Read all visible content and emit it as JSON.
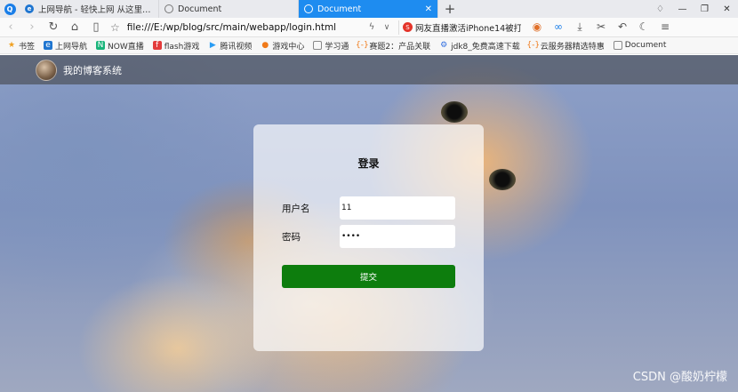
{
  "tabs": [
    {
      "title": "上网导航 - 轻快上网 从这里开始",
      "icon": "ie-icon",
      "active": false
    },
    {
      "title": "Document",
      "icon": "globe-icon",
      "active": false
    },
    {
      "title": "Document",
      "icon": "globe-icon",
      "active": true
    }
  ],
  "address_bar": {
    "url": "file:///E:/wp/blog/src/main/webapp/login.html"
  },
  "search_box": {
    "text": "网友直播激活iPhone14被打"
  },
  "bookmarks": [
    {
      "label": "书签",
      "icon": "star-icon"
    },
    {
      "label": "上网导航",
      "icon": "ie-icon"
    },
    {
      "label": "NOW直播",
      "icon": "now-icon"
    },
    {
      "label": "flash游戏",
      "icon": "flash-icon"
    },
    {
      "label": "腾讯视频",
      "icon": "play-icon"
    },
    {
      "label": "游戏中心",
      "icon": "gamepad-icon"
    },
    {
      "label": "学习通",
      "icon": "globe-icon"
    },
    {
      "label": "赛题2：产品关联",
      "icon": "code-icon"
    },
    {
      "label": "jdk8_免费高速下载",
      "icon": "gear-icon"
    },
    {
      "label": "云服务器精选特惠",
      "icon": "code-icon"
    },
    {
      "label": "Document",
      "icon": "globe-icon"
    }
  ],
  "site": {
    "title": "我的博客系统"
  },
  "login": {
    "title": "登录",
    "username_label": "用户名",
    "username_value": "11",
    "password_label": "密码",
    "password_value": "1111",
    "submit_label": "提交"
  },
  "watermark": "CSDN @酸奶柠檬"
}
